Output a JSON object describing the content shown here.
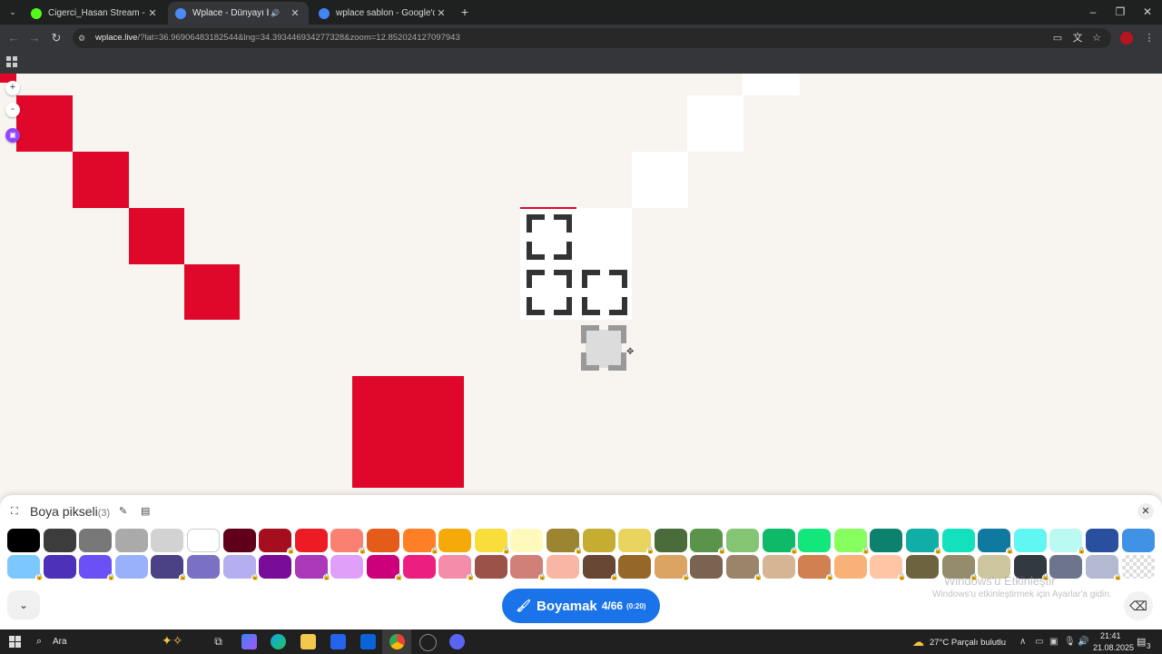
{
  "browser": {
    "tabs": [
      {
        "title": "Cigerci_Hasan Stream - Watch L",
        "favicon_color": "#53fc18",
        "active": false
      },
      {
        "title": "Wplace - Dünyayı boya",
        "favicon_color": "#4c8bf5",
        "active": true
      },
      {
        "title": "wplace sablon - Google'da Ara",
        "favicon_color": "#4285f4",
        "active": false
      }
    ],
    "new_tab": "+",
    "url_host": "wplace.live",
    "url_rest": "/?lat=36.96906483182544&lng=34.393446934277328&zoom=12.852024127097943"
  },
  "map": {
    "zoom_in": "+",
    "zoom_out": "-"
  },
  "palette_panel": {
    "title": "Boya pikseli",
    "count": "(3)",
    "colors_row1": [
      "#000000",
      "#3c3c3c",
      "#787878",
      "#aaaaaa",
      "#d2d2d2",
      "#ffffff",
      "#600018",
      "#a50e1e",
      "#ed1c24",
      "#fa8072",
      "#e45c1a",
      "#ff7f27",
      "#f6aa09",
      "#f9dd3b",
      "#fffabc",
      "#9c8431",
      "#c5ad31",
      "#e8d45f",
      "#4a6b3a",
      "#5a944a",
      "#84c573",
      "#0eb968",
      "#13e67b",
      "#87ff5e",
      "#0c816e",
      "#10aea6",
      "#13e1be",
      "#0f799f",
      "#60f7f2",
      "#bbfaf2",
      "#28509e",
      "#4093e4"
    ],
    "colors_row2": [
      "#7dc7ff",
      "#4d31b8",
      "#6b50f6",
      "#99b1fb",
      "#4a4284",
      "#7a71c4",
      "#b5aef1",
      "#780c99",
      "#aa38b9",
      "#e09ff9",
      "#cb007a",
      "#ec1f80",
      "#f38da9",
      "#9b5249",
      "#d18078",
      "#fab6a4",
      "#684634",
      "#95682a",
      "#dba463",
      "#7b6352",
      "#9c846b",
      "#d6b594",
      "#d18051",
      "#f8b277",
      "#ffc5a5",
      "#6d643f",
      "#948c6b",
      "#cdc59e",
      "#333941",
      "#6d758d",
      "#b3b9d1",
      "transparent"
    ],
    "selected_color": "#ffffff",
    "paint_button": {
      "label": "Boyamak",
      "count": "4/66",
      "timer": "(0:20)"
    },
    "watermark_title": "Windows'u Etkinleştir",
    "watermark_sub": "Windows'u etkinleştirmek için Ayarlar'a gidin."
  },
  "taskbar": {
    "search_placeholder": "Ara",
    "weather": "27°C  Parçalı bulutlu",
    "time": "21:41",
    "date": "21.08.2025",
    "notification_count": "3"
  }
}
